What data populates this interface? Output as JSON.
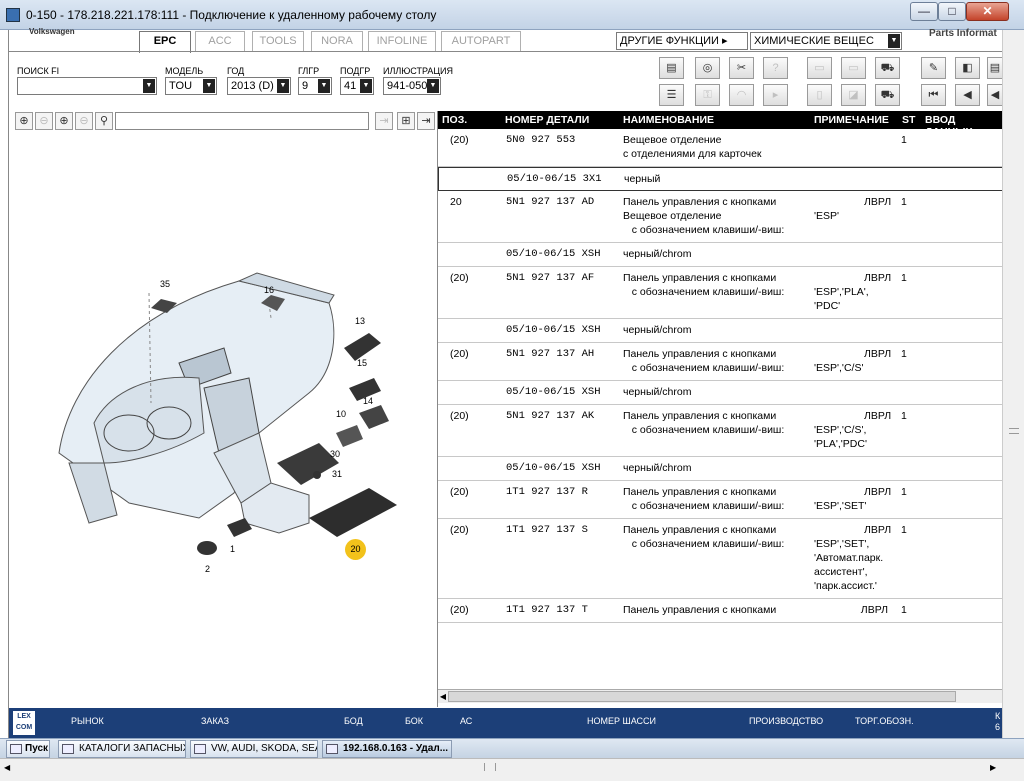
{
  "window": {
    "title": "0-150 - 178.218.221.178:111 - Подключение к удаленному рабочему столу",
    "min": "—",
    "max": "□",
    "close": "✕"
  },
  "app": {
    "brand": "Volkswagen",
    "parts_info": "Parts Informat",
    "tabs": [
      "EPC",
      "ACC",
      "TOOLS",
      "NORA",
      "INFOLINE",
      "AUTOPART"
    ],
    "other_functions": "ДРУГИЕ ФУНКЦИИ ▸",
    "chemicals": "ХИМИЧЕСКИЕ ВЕЩЕС"
  },
  "filters": {
    "search_label": "ПОИСК FI",
    "search_value": "",
    "model_label": "МОДЕЛЬ",
    "model_value": "TOU",
    "year_label": "ГОД",
    "year_value": "2013 (D)",
    "mg_label": "ГЛГР",
    "mg_value": "9",
    "sg_label": "ПОДГР",
    "sg_value": "41",
    "ill_label": "ИЛЛЮСТРАЦИЯ",
    "ill_value": "941-050"
  },
  "diagram": {
    "callouts": [
      "35",
      "16",
      "13",
      "15",
      "10",
      "14",
      "30",
      "31",
      "1",
      "2",
      "20"
    ]
  },
  "table": {
    "headers": {
      "pos": "ПОЗ.",
      "part": "НОМЕР ДЕТАЛИ",
      "name": "НАИМЕНОВАНИЕ",
      "note": "ПРИМЕЧАНИЕ",
      "st": "ST",
      "input": "ВВОД ДАННЫХ"
    },
    "rows": [
      {
        "pos": "(20)",
        "part": "5N0 927 553",
        "name": "Вещевое отделение\nс отделениями для карточек",
        "note": "",
        "st": "1"
      },
      {
        "pos": "",
        "part": "05/10-06/15 3X1",
        "name": "черный",
        "note": "",
        "st": ""
      },
      {
        "pos": "20",
        "part": "5N1 927 137 AD",
        "name": "Панель управления с кнопками\nВещевое отделение\n   с обозначением клавиши/-виш:",
        "note": "ЛВРЛ\n\n'ESP'",
        "st": "1"
      },
      {
        "pos": "",
        "part": "05/10-06/15 XSH",
        "name": "черный/chrom",
        "note": "",
        "st": ""
      },
      {
        "pos": "(20)",
        "part": "5N1 927 137 AF",
        "name": "Панель управления с кнопками\n   с обозначением клавиши/-виш:",
        "note": "ЛВРЛ\n'ESP','PLA',\n'PDC'",
        "st": "1"
      },
      {
        "pos": "",
        "part": "05/10-06/15 XSH",
        "name": "черный/chrom",
        "note": "",
        "st": ""
      },
      {
        "pos": "(20)",
        "part": "5N1 927 137 AH",
        "name": "Панель управления с кнопками\n   с обозначением клавиши/-виш:",
        "note": "ЛВРЛ\n'ESP','C/S'",
        "st": "1"
      },
      {
        "pos": "",
        "part": "05/10-06/15 XSH",
        "name": "черный/chrom",
        "note": "",
        "st": ""
      },
      {
        "pos": "(20)",
        "part": "5N1 927 137 AK",
        "name": "Панель управления с кнопками\n   с обозначением клавиши/-виш:",
        "note": "ЛВРЛ\n'ESP','C/S',\n'PLA','PDC'",
        "st": "1"
      },
      {
        "pos": "",
        "part": "05/10-06/15 XSH",
        "name": "черный/chrom",
        "note": "",
        "st": ""
      },
      {
        "pos": "(20)",
        "part": "1T1 927 137 R",
        "name": "Панель управления с кнопками\n   с обозначением клавиши/-виш:",
        "note": "ЛВРЛ\n'ESP','SET'",
        "st": "1"
      },
      {
        "pos": "(20)",
        "part": "1T1 927 137 S",
        "name": "Панель управления с кнопками\n   с обозначением клавиши/-виш:",
        "note": "ЛВРЛ\n'ESP','SET',\n'Автомат.парк.\nассистент',\n'парк.ассист.'",
        "st": "1"
      },
      {
        "pos": "(20)",
        "part": "1T1 927 137 T",
        "name": "Панель управления с кнопками",
        "note": "ЛВРЛ",
        "st": "1"
      }
    ]
  },
  "status": {
    "logo": "LEX\nCOM",
    "market": "РЫНОК",
    "order": "ЗАКАЗ",
    "bod": "БОД",
    "bok": "БОК",
    "ac": "АС",
    "chassis": "НОМЕР ШАССИ",
    "production": "ПРОИЗВОДСТВО",
    "trade": "ТОРГ.ОБОЗН.",
    "edge": "К\n6"
  },
  "taskbar": {
    "start": "Пуск",
    "items": [
      "КАТАЛОГИ ЗАПАСНЫХ ...",
      "VW, AUDI, SKODA, SEAT",
      "192.168.0.163 - Удал..."
    ]
  },
  "colors": {
    "status_bg": "#1c3f78",
    "callout_highlight": "#f2c21b"
  }
}
